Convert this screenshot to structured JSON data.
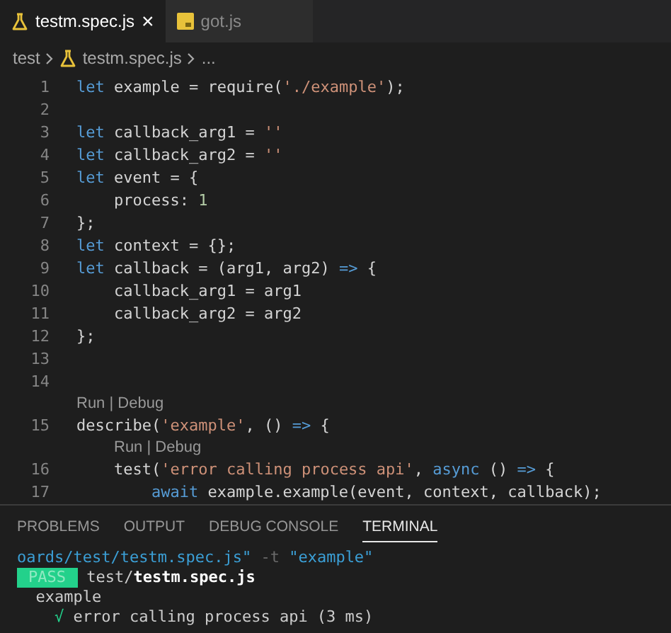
{
  "tabs": [
    {
      "label": "testm.spec.js",
      "kind": "flask",
      "selected": true,
      "close": "×"
    },
    {
      "label": "got.js",
      "kind": "js",
      "selected": false
    }
  ],
  "breadcrumb": [
    {
      "kind": "folder",
      "label": "test"
    },
    {
      "kind": "file",
      "label": "testm.spec.js"
    },
    {
      "kind": "more",
      "label": "..."
    }
  ],
  "editor": {
    "lines": [
      {
        "number": "1",
        "tokens": [
          {
            "kind": "keyword",
            "text": "let"
          },
          {
            "kind": "text",
            "text": " example = require("
          },
          {
            "kind": "string",
            "text": "'./example'"
          },
          {
            "kind": "text",
            "text": ");"
          }
        ]
      },
      {
        "number": "2"
      },
      {
        "number": "3",
        "tokens": [
          {
            "kind": "keyword",
            "text": "let"
          },
          {
            "kind": "text",
            "text": " callback_arg1 = "
          },
          {
            "kind": "string",
            "text": "''"
          }
        ]
      },
      {
        "number": "4",
        "tokens": [
          {
            "kind": "keyword",
            "text": "let"
          },
          {
            "kind": "text",
            "text": " callback_arg2 = "
          },
          {
            "kind": "string",
            "text": "''"
          }
        ]
      },
      {
        "number": "5",
        "tokens": [
          {
            "kind": "keyword",
            "text": "let"
          },
          {
            "kind": "text",
            "text": " event = {"
          }
        ]
      },
      {
        "number": "6",
        "tokens": [
          {
            "kind": "text",
            "text": "    process: "
          },
          {
            "kind": "number",
            "text": "1"
          }
        ]
      },
      {
        "number": "7",
        "tokens": [
          {
            "kind": "text",
            "text": "};"
          }
        ]
      },
      {
        "number": "8",
        "tokens": [
          {
            "kind": "keyword",
            "text": "let"
          },
          {
            "kind": "text",
            "text": " context = {};"
          }
        ]
      },
      {
        "number": "9",
        "tokens": [
          {
            "kind": "keyword",
            "text": "let"
          },
          {
            "kind": "text",
            "text": " callback = (arg1, arg2) "
          },
          {
            "kind": "keyword",
            "text": "=>"
          },
          {
            "kind": "text",
            "text": " {"
          }
        ]
      },
      {
        "number": "10",
        "tokens": [
          {
            "kind": "text",
            "text": "    callback_arg1 = arg1"
          }
        ]
      },
      {
        "number": "11",
        "tokens": [
          {
            "kind": "text",
            "text": "    callback_arg2 = arg2"
          }
        ]
      },
      {
        "number": "12",
        "tokens": [
          {
            "kind": "text",
            "text": "};"
          }
        ]
      },
      {
        "number": "13"
      },
      {
        "number": "14"
      },
      {
        "number": "15",
        "codelens": "Run | Debug",
        "tokens": [
          {
            "kind": "text",
            "text": "describe("
          },
          {
            "kind": "string",
            "text": "'example'"
          },
          {
            "kind": "text",
            "text": ", () "
          },
          {
            "kind": "keyword",
            "text": "=>"
          },
          {
            "kind": "text",
            "text": " {"
          }
        ]
      },
      {
        "number": "16",
        "codelens": "Run | Debug",
        "tokens": [
          {
            "kind": "text",
            "text": "    test("
          },
          {
            "kind": "string",
            "text": "'error calling process api'"
          },
          {
            "kind": "text",
            "text": ", "
          },
          {
            "kind": "keyword",
            "text": "async"
          },
          {
            "kind": "text",
            "text": " () "
          },
          {
            "kind": "keyword",
            "text": "=>"
          },
          {
            "kind": "text",
            "text": " {"
          }
        ]
      },
      {
        "number": "17",
        "tokens": [
          {
            "kind": "keyword",
            "text": "        await"
          },
          {
            "kind": "text",
            "text": " example.example(event, context, callback);"
          }
        ]
      }
    ]
  },
  "panel": {
    "tabs": [
      {
        "label": "PROBLEMS",
        "selected": false
      },
      {
        "label": "OUTPUT",
        "selected": false
      },
      {
        "label": "DEBUG CONSOLE",
        "selected": false
      },
      {
        "label": "TERMINAL",
        "selected": true
      }
    ],
    "terminal": [
      [
        {
          "kind": "path",
          "text": "oards/test/testm.spec.js\""
        },
        {
          "kind": "flag",
          "text": " -t "
        },
        {
          "kind": "path",
          "text": "\"example\""
        }
      ],
      [
        {
          "kind": "badge",
          "text": "PASS"
        },
        {
          "kind": "text",
          "text": " test/"
        },
        {
          "kind": "bold",
          "text": "testm.spec.js"
        }
      ],
      [
        {
          "kind": "text",
          "text": "  example"
        }
      ],
      [
        {
          "kind": "check",
          "text": "    √"
        },
        {
          "kind": "text",
          "text": " error calling process api (3 ms)"
        }
      ]
    ]
  }
}
